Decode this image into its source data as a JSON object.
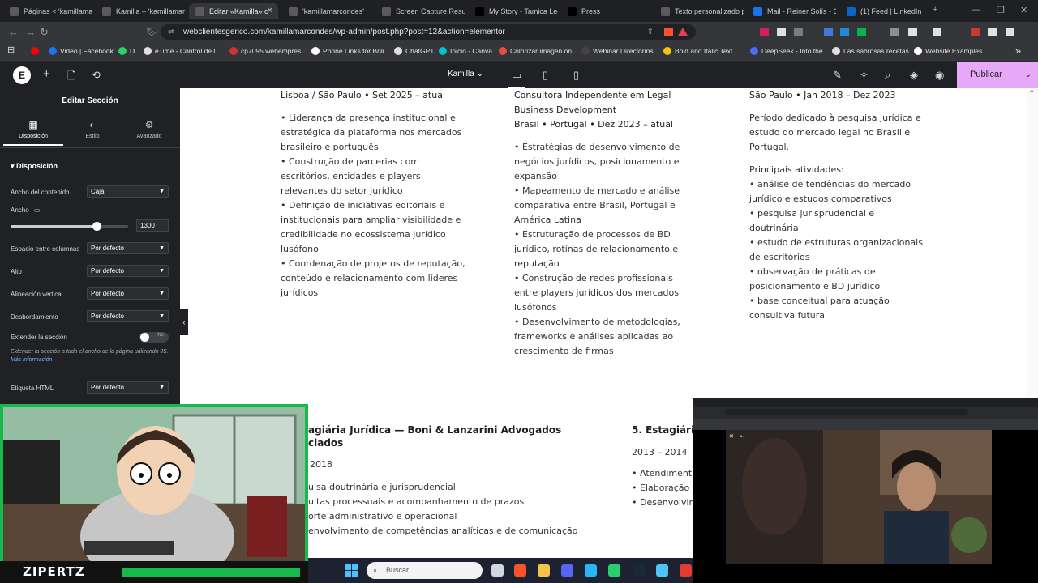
{
  "browser": {
    "tabs": [
      {
        "label": "Páginas < ‘kamillamar",
        "icon_color": "#5b5b5b"
      },
      {
        "label": "Kamilla – ‘kamillamar",
        "icon_color": "#5b5b5b"
      },
      {
        "label": "Editar «Kamilla» c",
        "icon_color": "#5b5b5b",
        "active": true
      },
      {
        "label": "'kamillamarcondes'",
        "icon_color": "#5b5b5b"
      },
      {
        "label": "Screen Capture Result",
        "icon_color": "#5b5b5b"
      },
      {
        "label": "My Story - Tamica Lee",
        "icon_color": "#000000"
      },
      {
        "label": "Press",
        "icon_color": "#000000"
      },
      {
        "label": "Texto personalizado pa",
        "icon_color": "#5b5b5b"
      },
      {
        "label": "Mail - Reiner Solís - Ou",
        "icon_color": "#1a73e8"
      },
      {
        "label": "(1) Feed | LinkedIn",
        "icon_color": "#0a66c2"
      }
    ],
    "url": "webclientesgerico.com/kamillamarcondes/wp-admin/post.php?post=12&action=elementor",
    "bookmarks": [
      {
        "label": "",
        "color": "#ff0000"
      },
      {
        "label": "Video | Facebook",
        "color": "#1877f2"
      },
      {
        "label": "D",
        "color": "#25d366"
      },
      {
        "label": "eTime - Control de l...",
        "color": "#e0e0e0"
      },
      {
        "label": "cp7095.webempres...",
        "color": "#cc3333"
      },
      {
        "label": "Phone Links for Boli...",
        "color": "#ffffff"
      },
      {
        "label": "ChatGPT",
        "color": "#e0e0e0"
      },
      {
        "label": "Inicio - Canva",
        "color": "#00c4cc"
      },
      {
        "label": "Colorizar imagen on...",
        "color": "#e74c3c"
      },
      {
        "label": "Webinar Directorios...",
        "color": "#444444"
      },
      {
        "label": "Bold and Italic Text...",
        "color": "#f1c40f"
      },
      {
        "label": "DeepSeek - Into the...",
        "color": "#4d6bfe"
      },
      {
        "label": "Las sabrosas recetas...",
        "color": "#e0e0e0"
      },
      {
        "label": "Website Examples...",
        "color": "#ffffff"
      }
    ]
  },
  "editor": {
    "page_name": "Kamilla",
    "publish_label": "Publicar",
    "panel_title": "Editar Sección",
    "panel_tabs": [
      "Disposición",
      "Estilo",
      "Avanzado"
    ],
    "section_title": "Disposición",
    "controls": [
      {
        "label": "Ancho del contenido",
        "value": "Caja"
      },
      {
        "label": "Ancho",
        "value": "1300",
        "slider_fraction": 0.73
      },
      {
        "label": "Espacio entre columnas",
        "value": "Por defecto"
      },
      {
        "label": "Alto",
        "value": "Por defecto"
      },
      {
        "label": "Alineación vertical",
        "value": "Por defecto"
      },
      {
        "label": "Desbordamiento",
        "value": "Por defecto"
      },
      {
        "label": "Extender la sección",
        "value": "No"
      },
      {
        "label": "Etiqueta HTML",
        "value": "Por defecto"
      }
    ],
    "help_text": "Extender la sección a todo el ancho de la página utilizando JS.",
    "help_link": "Más información"
  },
  "content": {
    "col1": {
      "header": "Lisboa / São Paulo • Set 2025 – atual",
      "items": [
        "• Liderança da presença institucional e estratégica da plataforma nos mercados brasileiro e português",
        "• Construção de parcerias com escritórios, entidades e players relevantes do setor jurídico",
        "• Definição de iniciativas editoriais e institucionais para ampliar visibilidade e credibilidade no ecossistema jurídico lusófono",
        "• Coordenação de projetos de reputação, conteúdo e relacionamento com líderes jurídicos"
      ]
    },
    "col2": {
      "header1": "Consultora Independente em Legal Business Development",
      "header2": "Brasil • Portugal • Dez 2023 – atual",
      "items": [
        "• Estratégias de desenvolvimento de negócios jurídicos, posicionamento e expansão",
        "• Mapeamento de mercado e análise comparativa entre Brasil, Portugal e América Latina",
        "• Estruturação de processos de BD jurídico, rotinas de relacionamento e reputação",
        "• Construção de redes profissionais entre players jurídicos dos mercados lusófonos",
        "• Desenvolvimento de metodologias, frameworks e análises aplicadas ao crescimento de firmas"
      ]
    },
    "col3": {
      "header": "São Paulo • Jan 2018 – Dez 2023",
      "intro": "Período dedicado à pesquisa jurídica e estudo do mercado legal no Brasil e Portugal.",
      "sub": "Principais atividades:",
      "items": [
        "• análise de tendências do mercado jurídico e estudos comparativos",
        "• pesquisa jurisprudencial e doutrinária",
        "• estudo de estruturas organizacionais de escritórios",
        "• observação de práticas de posicionamento e BD jurídico",
        "• base conceitual para atuação consultiva futura"
      ]
    },
    "sec2_left": {
      "title_l1": "agiária Jurídica — Boni & Lanzarini Advogados",
      "title_l2": "ciados",
      "date": "2018",
      "items": [
        "uisa doutrinária e jurisprudencial",
        "ultas processuais e acompanhamento de prazos",
        "orte administrativo e operacional",
        "envolvimento de competências analíticas e de comunicação"
      ]
    },
    "sec2_right": {
      "title": "5. Estagiári",
      "date": "2013 – 2014",
      "items": [
        "• Atendiment",
        "• Elaboração c",
        "• Desenvolvim"
      ]
    }
  },
  "overlay": {
    "streamer_name": "ZIPERTZ",
    "taskbar_search": "Buscar"
  }
}
